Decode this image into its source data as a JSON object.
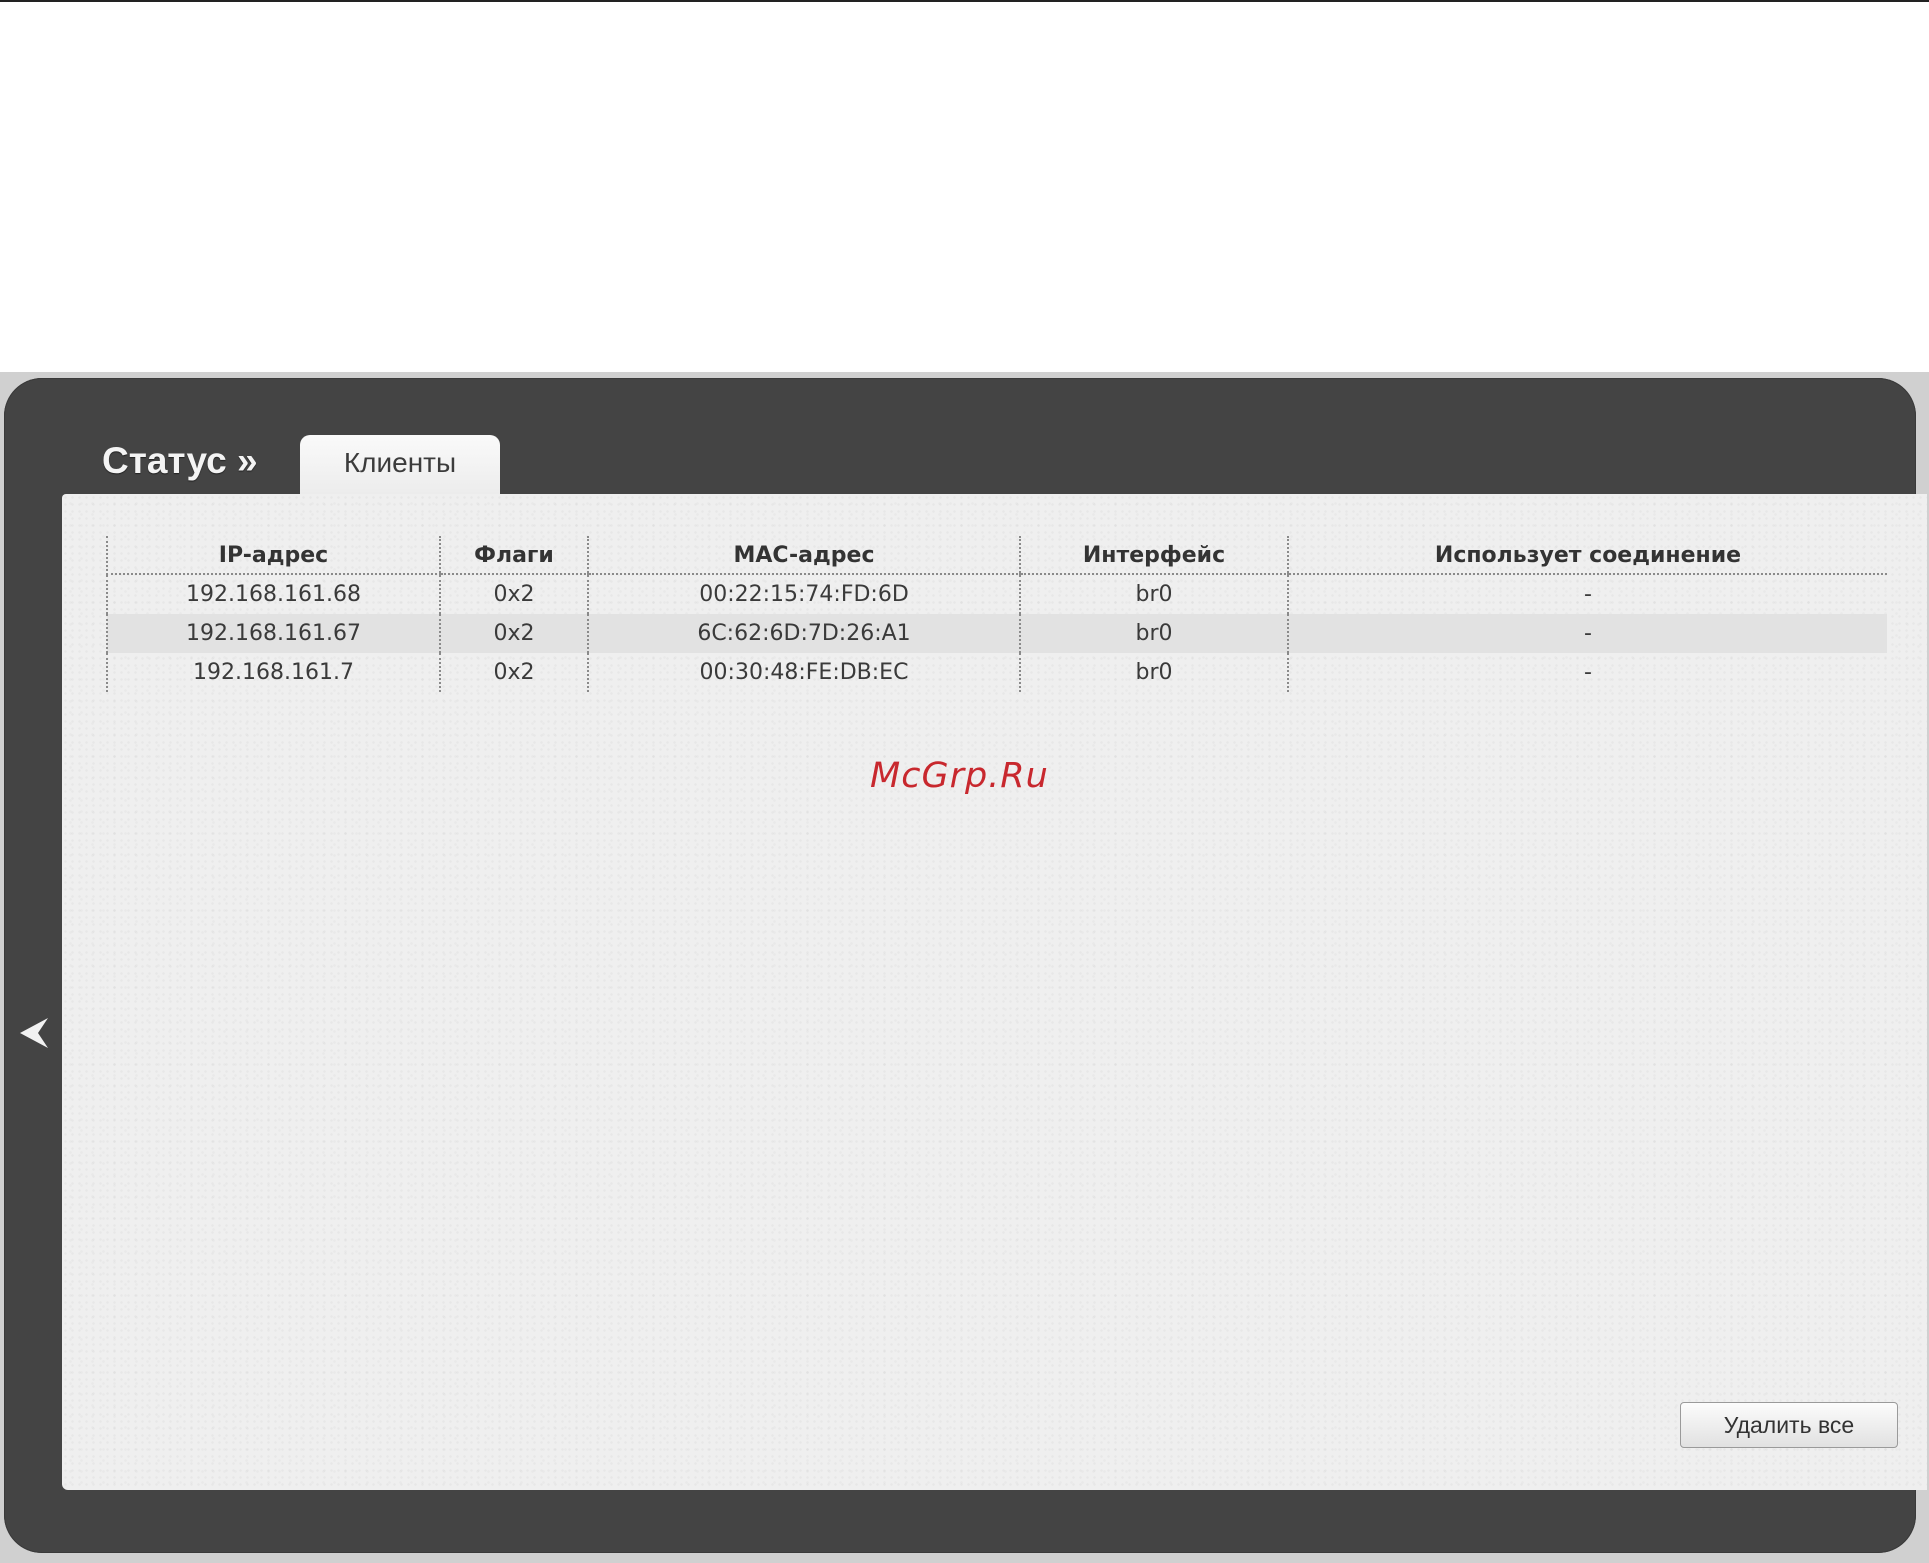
{
  "page": {
    "title": "Статус »",
    "active_tab": "Клиенты"
  },
  "table": {
    "columns": [
      "IP-адрес",
      "Флаги",
      "MAC-адрес",
      "Интерфейс",
      "Использует соединение"
    ],
    "rows": [
      {
        "ip": "192.168.161.68",
        "flags": "0x2",
        "mac": "00:22:15:74:FD:6D",
        "iface": "br0",
        "conn": "-"
      },
      {
        "ip": "192.168.161.67",
        "flags": "0x2",
        "mac": "6C:62:6D:7D:26:A1",
        "iface": "br0",
        "conn": "-"
      },
      {
        "ip": "192.168.161.7",
        "flags": "0x2",
        "mac": "00:30:48:FE:DB:EC",
        "iface": "br0",
        "conn": "-"
      }
    ]
  },
  "watermark": "McGrp.Ru",
  "actions": {
    "delete_all_label": "Удалить все"
  },
  "icons": {
    "back": "arrow-left-icon"
  },
  "colors": {
    "panel": "#444444",
    "content": "#efefef",
    "watermark": "#c8282e"
  }
}
